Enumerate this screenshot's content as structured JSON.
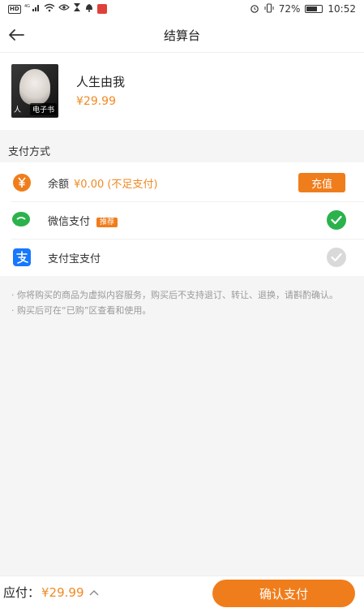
{
  "status_bar": {
    "network": "HD",
    "signal": "4G",
    "battery_percent": "72%",
    "battery_level": 0.72,
    "time": "10:52"
  },
  "header": {
    "title": "结算台"
  },
  "product": {
    "title": "人生由我",
    "price": "¥29.99",
    "cover_badge": "电子书",
    "cover_letter": "人"
  },
  "payment": {
    "section_label": "支付方式",
    "balance": {
      "label": "余额",
      "detail": "¥0.00 (不足支付)",
      "button": "充值",
      "icon": "yen-coin-icon",
      "color": "#f07d1c"
    },
    "wechat": {
      "label": "微信支付",
      "tag": "推荐",
      "selected": true,
      "icon": "wechat-icon",
      "color": "#2bb24c"
    },
    "alipay": {
      "label": "支付宝支付",
      "selected": false,
      "icon": "alipay-icon",
      "color": "#1677ff"
    }
  },
  "notice": {
    "line1": "· 你将购买的商品为虚拟内容服务，购买后不支持退订、转让、退换，请斟酌确认。",
    "line2": "· 购买后可在“已购”区查看和使用。"
  },
  "footer": {
    "total_label": "应付：",
    "total_amount": "¥29.99",
    "confirm_button": "确认支付",
    "accent": "#f07d1c"
  }
}
